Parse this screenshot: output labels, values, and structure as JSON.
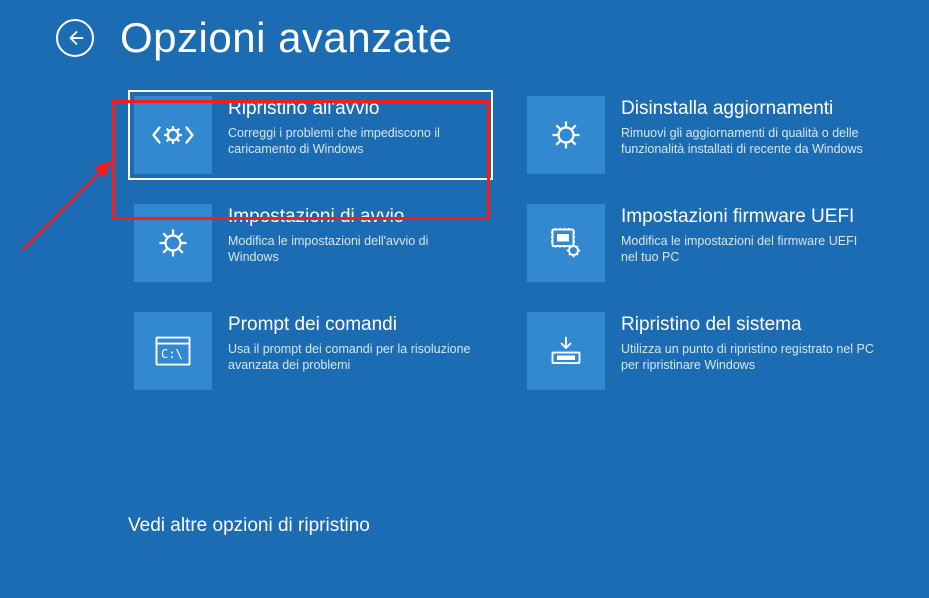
{
  "header": {
    "title": "Opzioni avanzate"
  },
  "options": [
    {
      "title": "Ripristino all'avvio",
      "desc": "Correggi i problemi che impediscono il caricamento di Windows",
      "icon": "startup-repair",
      "selected": true
    },
    {
      "title": "Disinstalla aggiornamenti",
      "desc": "Rimuovi gli aggiornamenti di qualità o delle funzionalità installati di recente da Windows",
      "icon": "uninstall-updates"
    },
    {
      "title": "Impostazioni di avvio",
      "desc": "Modifica le impostazioni dell'avvio di Windows",
      "icon": "startup-settings"
    },
    {
      "title": "Impostazioni firmware UEFI",
      "desc": "Modifica le impostazioni del firmware UEFI nel tuo PC",
      "icon": "uefi"
    },
    {
      "title": "Prompt dei comandi",
      "desc": "Usa il prompt dei comandi per la risoluzione avanzata dei problemi",
      "icon": "command-prompt"
    },
    {
      "title": "Ripristino del sistema",
      "desc": "Utilizza un punto di ripristino registrato nel PC per ripristinare Windows",
      "icon": "system-restore"
    }
  ],
  "see_more": "Vedi altre opzioni di ripristino",
  "colors": {
    "background": "#1b6cb3",
    "tile_bg": "#3389cf",
    "annotation": "#ff1a1a"
  }
}
